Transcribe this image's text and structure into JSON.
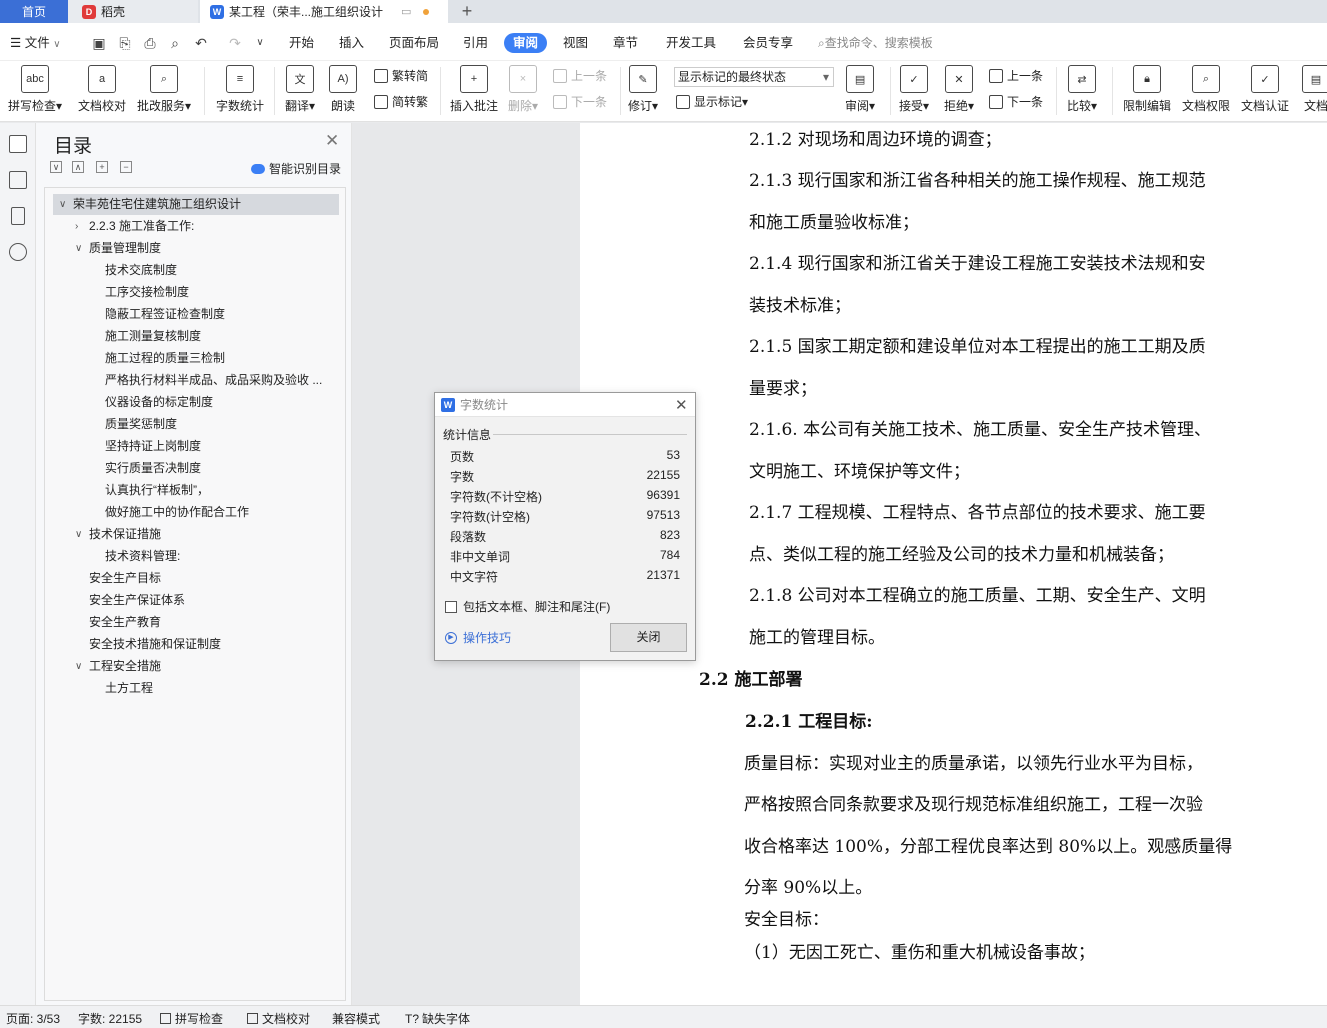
{
  "tabs": {
    "home": "首页",
    "daoke": "稻壳",
    "doc": "某工程（荣丰...施工组织设计"
  },
  "menu": {
    "file": "文件",
    "items": [
      "开始",
      "插入",
      "页面布局",
      "引用",
      "审阅",
      "视图",
      "章节",
      "开发工具",
      "会员专享"
    ],
    "active": "审阅",
    "search_placeholder": "查找命令、搜索模板"
  },
  "ribbon": {
    "spell": "拼写检查",
    "proof": "文档校对",
    "batch": "批改服务",
    "wordcount": "字数统计",
    "translate": "翻译",
    "read": "朗读",
    "to_trad": "繁转简",
    "to_simp": "简转繁",
    "insert_comment": "插入批注",
    "delete": "删除",
    "prev": "上一条",
    "next": "下一条",
    "revise": "修订",
    "markup_state": "显示标记的最终状态",
    "show_markup": "显示标记",
    "review": "审阅",
    "accept": "接受",
    "reject": "拒绝",
    "prev2": "上一条",
    "next2": "下一条",
    "compare": "比较",
    "restrict": "限制编辑",
    "permission": "文档权限",
    "certify": "文档认证",
    "more": "文档"
  },
  "toc": {
    "title": "目录",
    "smart": "智能识别目录",
    "items": [
      {
        "label": "荣丰苑住宅住建筑施工组织设计",
        "indent": 0,
        "arrow": "down",
        "selected": true
      },
      {
        "label": "2.2.3 施工准备工作:",
        "indent": 1,
        "arrow": "right"
      },
      {
        "label": "质量管理制度",
        "indent": 1,
        "arrow": "down"
      },
      {
        "label": "技术交底制度",
        "indent": 2
      },
      {
        "label": "工序交接检制度",
        "indent": 2
      },
      {
        "label": "隐蔽工程签证检查制度",
        "indent": 2
      },
      {
        "label": "施工测量复核制度",
        "indent": 2
      },
      {
        "label": "施工过程的质量三检制",
        "indent": 2
      },
      {
        "label": "严格执行材料半成品、成品采购及验收 ...",
        "indent": 2
      },
      {
        "label": "仪器设备的标定制度",
        "indent": 2
      },
      {
        "label": "质量奖惩制度",
        "indent": 2
      },
      {
        "label": "坚持持证上岗制度",
        "indent": 2
      },
      {
        "label": "实行质量否决制度",
        "indent": 2
      },
      {
        "label": "认真执行“样板制”，",
        "indent": 2
      },
      {
        "label": "做好施工中的协作配合工作",
        "indent": 2
      },
      {
        "label": "技术保证措施",
        "indent": 1,
        "arrow": "down"
      },
      {
        "label": "技术资料管理:",
        "indent": 2
      },
      {
        "label": "安全生产目标",
        "indent": 1
      },
      {
        "label": "安全生产保证体系",
        "indent": 1
      },
      {
        "label": "安全生产教育",
        "indent": 1
      },
      {
        "label": "安全技术措施和保证制度",
        "indent": 1
      },
      {
        "label": "工程安全措施",
        "indent": 1,
        "arrow": "down"
      },
      {
        "label": "土方工程",
        "indent": 2
      }
    ]
  },
  "document": {
    "lines": [
      "2.1.2 对现场和周边环境的调查；",
      "2.1.3 现行国家和浙江省各种相关的施工操作规程、施工规范",
      "和施工质量验收标准；",
      "2.1.4 现行国家和浙江省关于建设工程施工安装技术法规和安",
      "装技术标准；",
      "2.1.5 国家工期定额和建设单位对本工程提出的施工工期及质",
      "量要求；",
      "2.1.6. 本公司有关施工技术、施工质量、安全生产技术管理、",
      "文明施工、环境保护等文件；",
      "2.1.7 工程规模、工程特点、各节点部位的技术要求、施工要",
      "点、类似工程的施工经验及公司的技术力量和机械装备；",
      "2.1.8 公司对本工程确立的施工质量、工期、安全生产、文明",
      "施工的管理目标。",
      "2.2 施工部署",
      "2.2.1 工程目标:",
      "质量目标：实现对业主的质量承诺，以领先行业水平为目标，",
      "严格按照合同条款要求及现行规范标准组织施工，工程一次验",
      "收合格率达 100%，分部工程优良率达到 80%以上。观感质量得",
      "分率 90%以上。",
      "安全目标：",
      "（1）无因工死亡、重伤和重大机械设备事故；"
    ]
  },
  "dialog": {
    "title": "字数统计",
    "section": "统计信息",
    "stats": [
      {
        "k": "页数",
        "v": "53"
      },
      {
        "k": "字数",
        "v": "22155"
      },
      {
        "k": "字符数(不计空格)",
        "v": "96391"
      },
      {
        "k": "字符数(计空格)",
        "v": "97513"
      },
      {
        "k": "段落数",
        "v": "823"
      },
      {
        "k": "非中文单词",
        "v": "784"
      },
      {
        "k": "中文字符",
        "v": "21371"
      }
    ],
    "include_label": "包括文本框、脚注和尾注(F)",
    "tips": "操作技巧",
    "close": "关闭"
  },
  "status": {
    "page": "页面: 3/53",
    "words": "字数: 22155",
    "spell": "拼写检查",
    "proof": "文档校对",
    "compat": "兼容模式",
    "missing_font": "缺失字体"
  }
}
